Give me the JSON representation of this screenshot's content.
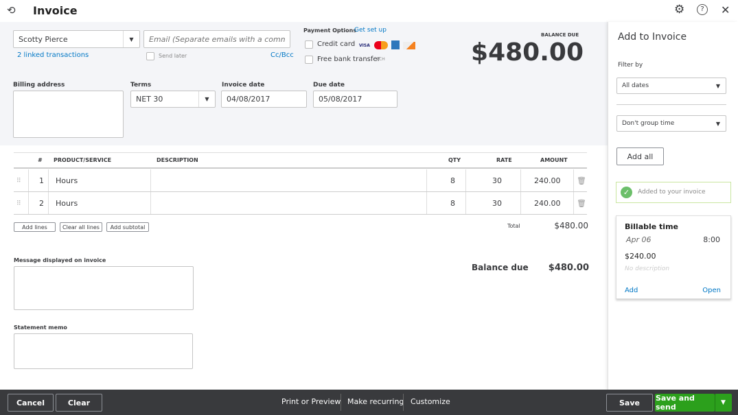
{
  "header": {
    "title": "Invoice"
  },
  "customer": {
    "name": "Scotty Pierce",
    "linked": "2 linked transactions"
  },
  "email": {
    "placeholder": "Email (Separate emails with a comma)",
    "send_later": "Send later",
    "ccbcc": "Cc/Bcc"
  },
  "payment": {
    "label": "Payment Options",
    "setup": "Get set up",
    "credit_card": "Credit card",
    "bank": "Free bank transfer",
    "ach": "ACH"
  },
  "balance": {
    "label": "BALANCE DUE",
    "amount": "$480.00"
  },
  "billing": {
    "label": "Billing address"
  },
  "terms": {
    "label": "Terms",
    "value": "NET 30"
  },
  "invoice_date": {
    "label": "Invoice date",
    "value": "04/08/2017"
  },
  "due_date": {
    "label": "Due date",
    "value": "05/08/2017"
  },
  "table": {
    "headers": [
      "#",
      "PRODUCT/SERVICE",
      "DESCRIPTION",
      "QTY",
      "RATE",
      "AMOUNT"
    ],
    "rows": [
      {
        "num": "1",
        "product": "Hours",
        "description": "",
        "qty": "8",
        "rate": "30",
        "amount": "240.00"
      },
      {
        "num": "2",
        "product": "Hours",
        "description": "",
        "qty": "8",
        "rate": "30",
        "amount": "240.00"
      }
    ]
  },
  "buttons": {
    "add_lines": "Add lines",
    "clear_lines": "Clear all lines",
    "add_subtotal": "Add subtotal"
  },
  "totals": {
    "total_label": "Total",
    "total": "$480.00",
    "balance_label": "Balance due",
    "balance": "$480.00"
  },
  "message": {
    "label": "Message displayed on invoice"
  },
  "memo": {
    "label": "Statement memo"
  },
  "panel": {
    "title": "Add to Invoice",
    "filter_label": "Filter by",
    "filter": "All dates",
    "group": "Don't group time",
    "add_all": "Add all",
    "added": "Added to your invoice",
    "card": {
      "title": "Billable time",
      "date": "Apr 06",
      "hours": "8:00",
      "amount": "$240.00",
      "description": "No description",
      "add": "Add",
      "open": "Open"
    }
  },
  "footer": {
    "cancel": "Cancel",
    "clear": "Clear",
    "print": "Print or Preview",
    "recurring": "Make recurring",
    "customize": "Customize",
    "save": "Save",
    "save_send": "Save and send"
  },
  "colors": {
    "accent": "#2ca01c",
    "link": "#0077c5",
    "footer": "#393a3d"
  }
}
